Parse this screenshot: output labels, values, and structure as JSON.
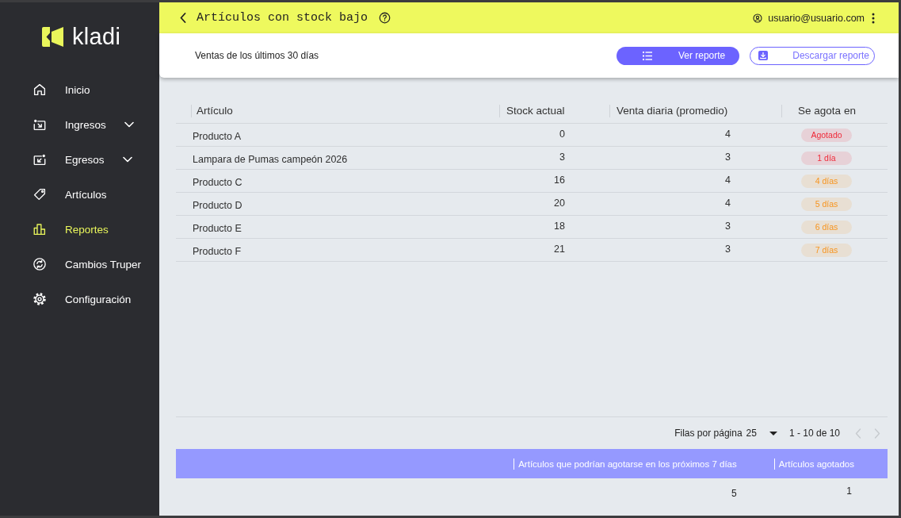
{
  "sidebar": {
    "logo": "kladi",
    "items": [
      {
        "label": "Inicio",
        "kind": "link",
        "selected": false
      },
      {
        "label": "Ingresos",
        "kind": "group",
        "selected": false
      },
      {
        "label": "Egresos",
        "kind": "group",
        "selected": false
      },
      {
        "label": "Artículos",
        "kind": "link",
        "selected": false
      },
      {
        "label": "Reportes",
        "kind": "link",
        "selected": true
      },
      {
        "label": "Cambios Truper",
        "kind": "link",
        "selected": false
      },
      {
        "label": "Configuración",
        "kind": "link",
        "selected": false
      }
    ]
  },
  "header": {
    "title": "Artículos con stock bajo",
    "user": "usuario@usuario.com"
  },
  "toolbar": {
    "period": "Ventas de los últimos 30 días",
    "buttons": [
      {
        "label": "Ver reporte",
        "kind": "primary"
      },
      {
        "label": "Descargar reporte",
        "kind": "outline"
      }
    ]
  },
  "table": {
    "columns": [
      "Artículo",
      "Stock actual",
      "Venta diaria (promedio)",
      "Se agota en"
    ],
    "rows": [
      {
        "article": "Producto A",
        "stock": "0",
        "daily_sales": "4",
        "runs_out_in": "Agotado",
        "color": "#ef2b3a"
      },
      {
        "article": "Lampara de Pumas campeón 2026",
        "stock": "3",
        "daily_sales": "3",
        "runs_out_in": "1 día",
        "color": "#ef2b3a"
      },
      {
        "article": "Producto C",
        "stock": "16",
        "daily_sales": "4",
        "runs_out_in": "4 días",
        "color": "#f7941d"
      },
      {
        "article": "Producto D",
        "stock": "20",
        "daily_sales": "4",
        "runs_out_in": "5 días",
        "color": "#f7941d"
      },
      {
        "article": "Producto E",
        "stock": "18",
        "daily_sales": "3",
        "runs_out_in": "6 días",
        "color": "#f7941d"
      },
      {
        "article": "Producto F",
        "stock": "21",
        "daily_sales": "3",
        "runs_out_in": "7 días",
        "color": "#f7941d"
      }
    ]
  },
  "pagination": {
    "label": "Filas por página",
    "rows_per_page": "25",
    "range": "1 - 10 de 10",
    "previous_disabled": true,
    "next_disabled": true
  },
  "summary": {
    "columns": [
      "Artículos que podrían agotarse en los próximos 7 días",
      "Artículos agotados"
    ],
    "values": [
      "5",
      "1"
    ]
  }
}
